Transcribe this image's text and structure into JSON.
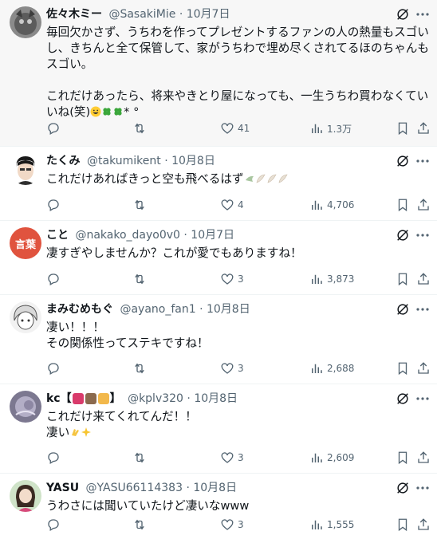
{
  "replies": [
    {
      "name": "佐々木ミー",
      "handle": "@SasakiMie",
      "sep": "·",
      "date": "10月7日",
      "text": "毎回欠かさず、うちわを作ってプレゼントするファンの人の熱量もスゴいし、きちんと全て保管して、家がうちわで埋め尽くされてるほのちゃんもスゴい。\n\nこれだけあったら、将来やきとり屋になっても、一生うちわ買わなくていいね(笑)",
      "text_tail": "* °",
      "likes": "41",
      "views": "1.3万"
    },
    {
      "name": "たくみ",
      "handle": "@takumikent",
      "sep": "·",
      "date": "10月8日",
      "text": "これだけあればきっと空も飛べるはず",
      "likes": "4",
      "views": "4,706"
    },
    {
      "name": "こと",
      "handle": "@nakako_dayo0v0",
      "sep": "·",
      "date": "10月7日",
      "text": "凄すぎやしませんか？これが愛でもありますね！",
      "avatar_text": "言葉",
      "likes": "3",
      "views": "3,873"
    },
    {
      "name": "まみむめもぐ",
      "handle": "@ayano_fan1",
      "sep": "·",
      "date": "10月8日",
      "text": "凄い！！！\nその関係性ってステキですね！",
      "likes": "3",
      "views": "2,688"
    },
    {
      "name": "kc【",
      "name_tail": "】",
      "handle": "@kplv320",
      "sep": "·",
      "date": "10月8日",
      "text": "これだけ来てくれてんだ！！\n凄い",
      "likes": "3",
      "views": "2,609"
    },
    {
      "name": "YASU",
      "handle": "@YASU66114383",
      "sep": "·",
      "date": "10月8日",
      "text": "うわさには聞いていたけど凄いなwww",
      "likes": "3",
      "views": "1,555"
    }
  ],
  "icons": {
    "reply": "reply-icon",
    "retweet": "retweet-icon",
    "like": "heart-icon",
    "views": "views-icon",
    "bookmark": "bookmark-icon",
    "share": "share-icon",
    "grok": "grok-icon",
    "more": "more-icon"
  },
  "colors": {
    "text": "#0f1419",
    "muted": "#536471",
    "divider": "#eff3f4",
    "highlight_bg": "#f7f7f7"
  }
}
